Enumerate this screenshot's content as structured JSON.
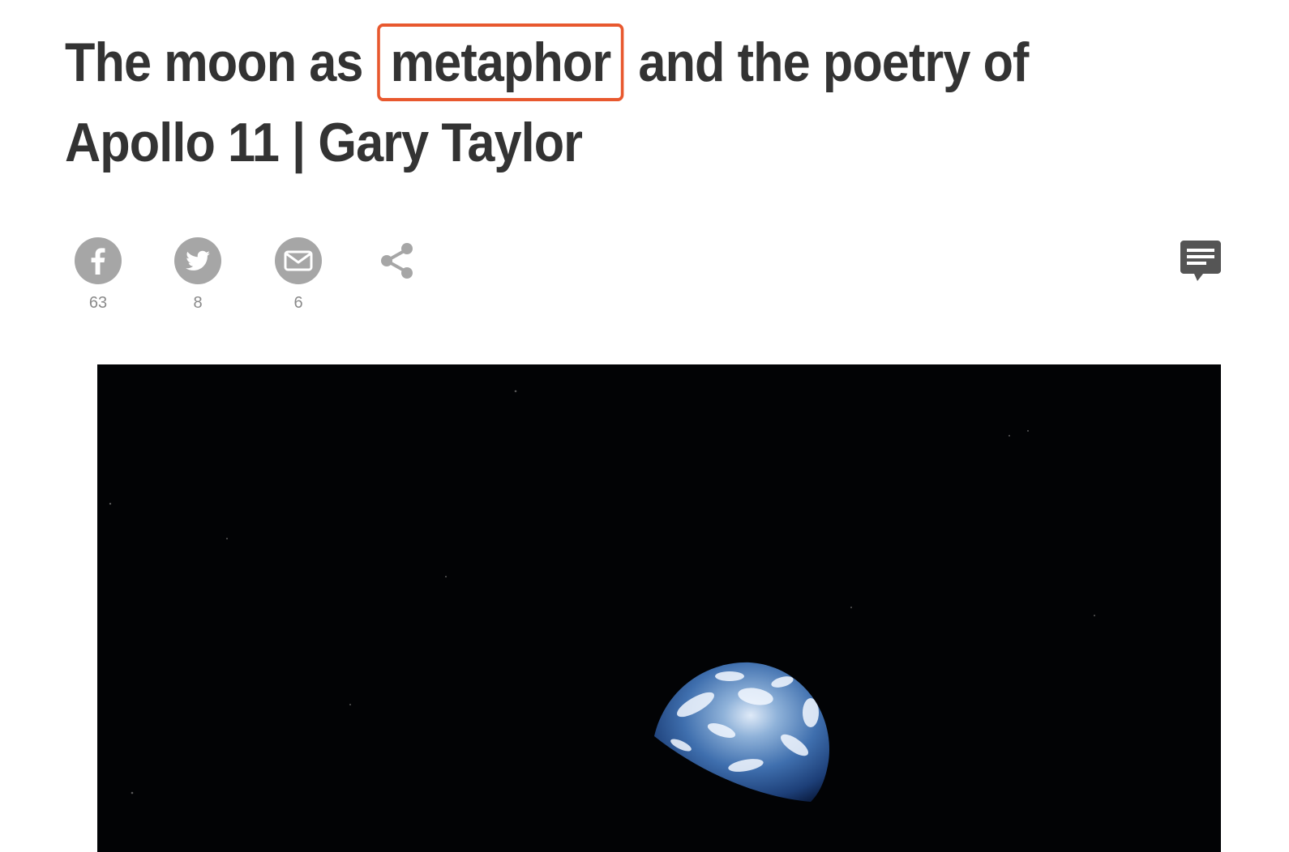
{
  "article": {
    "title_part1": "The moon as",
    "title_highlight": "metaphor",
    "title_part2": "and the poetry of Apollo 11 | Gary Taylor"
  },
  "share": {
    "facebook": {
      "icon": "facebook-icon",
      "count": "63"
    },
    "twitter": {
      "icon": "twitter-icon",
      "count": "8"
    },
    "email": {
      "icon": "email-icon",
      "count": "6"
    },
    "share": {
      "icon": "share-icon"
    },
    "comments": {
      "icon": "comment-icon"
    }
  },
  "colors": {
    "headline": "#333333",
    "highlight_border": "#e8582e",
    "icon_grey": "#a6a6a6",
    "count_grey": "#8a8a8a",
    "comment_icon": "#555555"
  }
}
